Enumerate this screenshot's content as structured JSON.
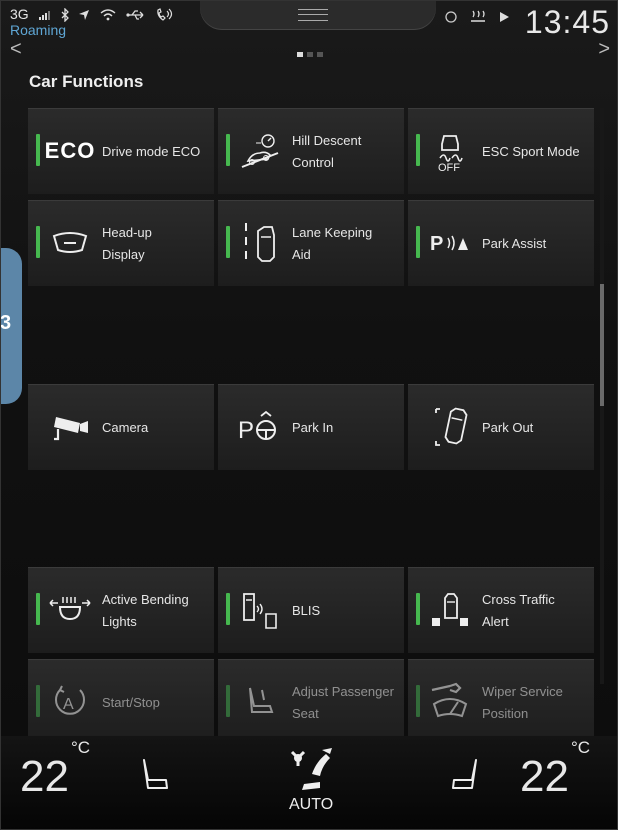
{
  "status_bar": {
    "network": "3G",
    "roaming": "Roaming",
    "time": "13:45",
    "left_icons": [
      "signal-icon",
      "bluetooth-icon",
      "location-icon",
      "wifi-icon",
      "usb-icon",
      "phone-icon"
    ],
    "right_icons": [
      "circle-icon",
      "heater-icon",
      "play-icon"
    ]
  },
  "page": {
    "title": "Car Functions",
    "page_dots": 3,
    "active_page": 1,
    "prev_arrow": "<",
    "next_arrow": ">"
  },
  "side_tab": {
    "label": "3"
  },
  "tiles": [
    {
      "label": "Drive mode ECO",
      "icon": "eco-icon",
      "active": true
    },
    {
      "label_line1": "Hill Descent",
      "label_line2": "Control",
      "icon": "hill-descent-icon",
      "active": true
    },
    {
      "label": "ESC Sport Mode",
      "icon": "esc-off-icon",
      "active": true,
      "icon_text": "OFF"
    },
    {
      "label_line1": "Head-up",
      "label_line2": "Display",
      "icon": "head-up-display-icon",
      "active": true
    },
    {
      "label_line1": "Lane Keeping",
      "label_line2": "Aid",
      "icon": "lane-keeping-icon",
      "active": true
    },
    {
      "label": "Park Assist",
      "icon": "park-assist-icon",
      "active": true,
      "icon_text": "P"
    },
    {
      "label": "Camera",
      "icon": "camera-icon",
      "active": false
    },
    {
      "label": "Park In",
      "icon": "park-in-icon",
      "active": false,
      "icon_text": "P"
    },
    {
      "label": "Park Out",
      "icon": "park-out-icon",
      "active": false
    },
    {
      "label_line1": "Active Bending",
      "label_line2": "Lights",
      "icon": "bending-lights-icon",
      "active": true
    },
    {
      "label": "BLIS",
      "icon": "blis-icon",
      "active": true
    },
    {
      "label_line1": "Cross Traffic",
      "label_line2": "Alert",
      "icon": "cross-traffic-icon",
      "active": true
    },
    {
      "label": "Start/Stop",
      "icon": "start-stop-icon",
      "active": true,
      "icon_text": "A"
    },
    {
      "label_line1": "Adjust Passenger",
      "label_line2": "Seat",
      "icon": "passenger-seat-icon",
      "active": true
    },
    {
      "label_line1": "Wiper Service",
      "label_line2": "Position",
      "icon": "wiper-service-icon",
      "active": true
    }
  ],
  "climate": {
    "left_temp": "22",
    "right_temp": "22",
    "unit": "°C",
    "mode": "AUTO"
  },
  "colors": {
    "indicator_active": "#46b84f",
    "roaming_text": "#5fa6d4",
    "side_tab": "#5c86a8"
  }
}
